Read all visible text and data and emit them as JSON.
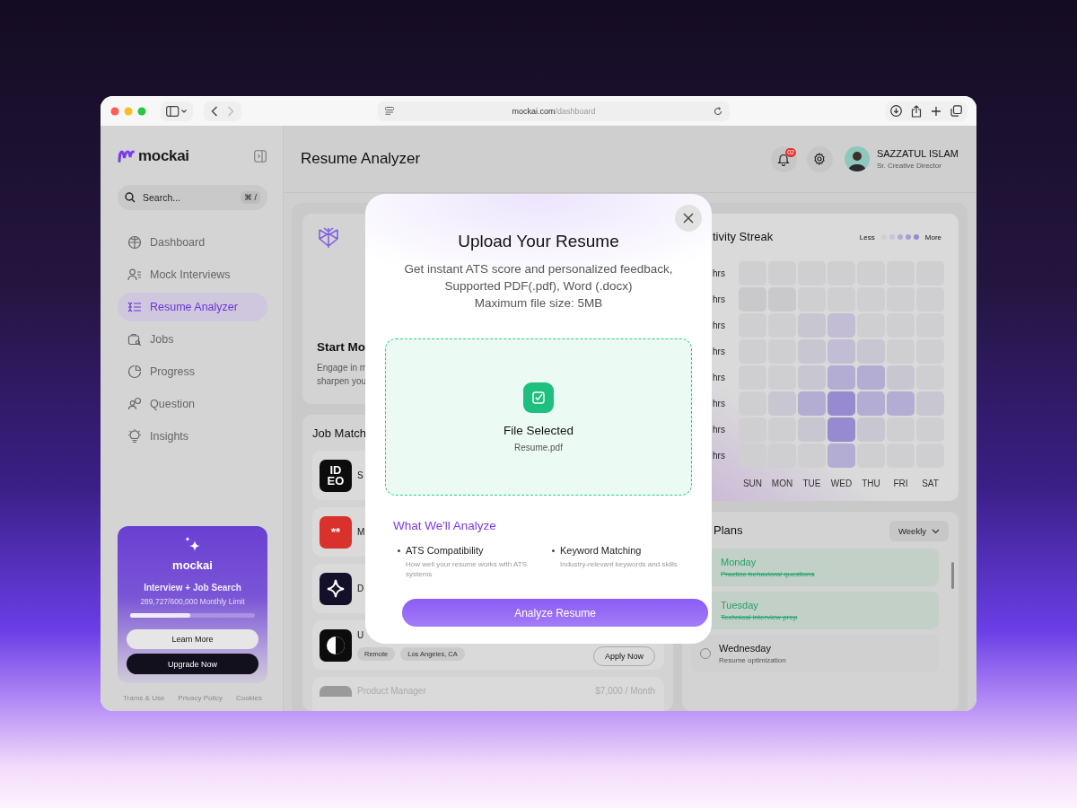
{
  "browser": {
    "url_host": "mockai.com",
    "url_path": "/dashboard"
  },
  "sidebar": {
    "brand": "mockai",
    "search": {
      "placeholder": "Search...",
      "shortcut": "⌘ /"
    },
    "items": [
      {
        "label": "Dashboard",
        "selected": false
      },
      {
        "label": "Mock Interviews",
        "selected": false
      },
      {
        "label": "Resume Analyzer",
        "selected": true
      },
      {
        "label": "Jobs",
        "selected": false
      },
      {
        "label": "Progress",
        "selected": false
      },
      {
        "label": "Question",
        "selected": false
      },
      {
        "label": "Insights",
        "selected": false
      }
    ],
    "promo": {
      "brand": "mockai",
      "title": "Interview + Job Search",
      "usage": "289,727/600,000 Monthly Limit",
      "level": 0.48,
      "buttons": [
        "Learn More",
        "Upgrade Now"
      ]
    },
    "footer_links": [
      "Trams & Use",
      "Privacy Policy",
      "Cookies"
    ]
  },
  "header": {
    "title": "Resume Analyzer",
    "notifications": "02",
    "user": {
      "name": "SAZZATUL ISLAM",
      "role": "Sr. Creative Director"
    }
  },
  "start_card": {
    "title": "Start Mo",
    "description_lines": [
      "Engage in m",
      "sharpen you"
    ]
  },
  "job_matches": {
    "title": "Job Match",
    "jobs": [
      {
        "kind": "letters",
        "logo_lines": [
          "ID",
          "EO"
        ],
        "title": "S"
      },
      {
        "kind": "red",
        "logo_lines": [
          "**"
        ],
        "title": "M"
      },
      {
        "kind": "sparkle",
        "title": "D"
      },
      {
        "kind": "half",
        "title": "U",
        "tags": [
          "Remote",
          "Los Angeles, CA"
        ],
        "action": "Apply Now"
      },
      {
        "kind": "fade",
        "title": "Product Manager",
        "salary": "$7,000 / Month"
      }
    ]
  },
  "activity": {
    "title": "tivity Streak",
    "legend_less": "Less",
    "legend_more": "More",
    "legend": [
      {
        "color": "#cfcfd1"
      },
      {
        "color": "#c8c6d1"
      },
      {
        "color": "#b3acd3"
      },
      {
        "color": "#a79cd2"
      },
      {
        "color": "#978ad1"
      }
    ],
    "rows": [
      {
        "label": "hrs",
        "cells": [
          {
            "color": "#cfcfd1"
          },
          {
            "color": "#cfcfd1"
          },
          {
            "color": "#cfcfd1"
          },
          {
            "color": "#cfcfd1"
          },
          {
            "color": "#cfcfd1"
          },
          {
            "color": "#cfcfd1"
          },
          {
            "color": "#cfcfd1"
          }
        ]
      },
      {
        "label": "hrs",
        "cells": [
          {
            "color": "#c9c9cb"
          },
          {
            "color": "#c9c9cb"
          },
          {
            "color": "#cfcfd1"
          },
          {
            "color": "#cfcfd1"
          },
          {
            "color": "#cfcfd1"
          },
          {
            "color": "#cfcfd1"
          },
          {
            "color": "#cfcfd1"
          }
        ]
      },
      {
        "label": "hrs",
        "cells": [
          {
            "color": "#cfcfd1"
          },
          {
            "color": "#cfcfd1"
          },
          {
            "color": "#c8c6d1"
          },
          {
            "color": "#c2bdd4"
          },
          {
            "color": "#cfcfd1"
          },
          {
            "color": "#cfcfd1"
          },
          {
            "color": "#cfcfd1"
          }
        ]
      },
      {
        "label": "hrs",
        "cells": [
          {
            "color": "#cfcfd1"
          },
          {
            "color": "#cfcfd1"
          },
          {
            "color": "#c8c6d1"
          },
          {
            "color": "#c2bdd4"
          },
          {
            "color": "#c8c6d1"
          },
          {
            "color": "#cfcfd1"
          },
          {
            "color": "#cfcfd1"
          }
        ]
      },
      {
        "label": "hrs",
        "cells": [
          {
            "color": "#cfcfd1"
          },
          {
            "color": "#cfcfd1"
          },
          {
            "color": "#c8c6d1"
          },
          {
            "color": "#b3acd3"
          },
          {
            "color": "#b3acd3"
          },
          {
            "color": "#c8c6d1"
          },
          {
            "color": "#cfcfd1"
          }
        ]
      },
      {
        "label": "hrs",
        "cells": [
          {
            "color": "#cfcfd1"
          },
          {
            "color": "#c8c6d1"
          },
          {
            "color": "#b3acd3"
          },
          {
            "color": "#978ad1"
          },
          {
            "color": "#b3acd3"
          },
          {
            "color": "#b3acd3"
          },
          {
            "color": "#c8c6d1"
          }
        ]
      },
      {
        "label": "hrs",
        "cells": [
          {
            "color": "#cfcfd1"
          },
          {
            "color": "#cfcfd1"
          },
          {
            "color": "#c8c6d1"
          },
          {
            "color": "#978ad1"
          },
          {
            "color": "#c8c6d1"
          },
          {
            "color": "#cfcfd1"
          },
          {
            "color": "#cfcfd1"
          }
        ]
      },
      {
        "label": "hrs",
        "cells": [
          {
            "color": "#cfcfd1"
          },
          {
            "color": "#cfcfd1"
          },
          {
            "color": "#cfcfd1"
          },
          {
            "color": "#b3acd3"
          },
          {
            "color": "#cfcfd1"
          },
          {
            "color": "#cfcfd1"
          },
          {
            "color": "#cfcfd1"
          }
        ]
      }
    ],
    "days": [
      "SUN",
      "MON",
      "TUE",
      "WED",
      "THU",
      "FRI",
      "SAT"
    ]
  },
  "plans": {
    "title": "Plans",
    "period": "Weekly",
    "items": [
      {
        "day": "Monday",
        "task": "Practice behavioral questions",
        "done": true
      },
      {
        "day": "Tuesday",
        "task": "Technical interview prep",
        "done": true
      },
      {
        "day": "Wednesday",
        "task": "Resume optimization",
        "done": false
      }
    ]
  },
  "modal": {
    "title": "Upload Your Resume",
    "description_lines": [
      "Get instant ATS score and personalized feedback,",
      "Supported PDF(.pdf), Word (.docx)",
      "Maximum file size: 5MB"
    ],
    "file": {
      "status": "File Selected",
      "name": "Resume.pdf"
    },
    "section_title": "What We'll Analyze",
    "features": [
      {
        "title": "ATS Compatibility",
        "description": "How well your resume works with ATS systems"
      },
      {
        "title": "Keyword Matching",
        "description": "Industry-relevant keywords and skills"
      }
    ],
    "button": "Analyze Resume"
  }
}
